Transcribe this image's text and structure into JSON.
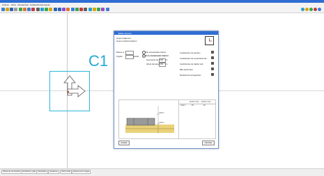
{
  "menu": [
    "Archivo",
    "Obra",
    "Introducción",
    "Gráfica/Ventas",
    "Ayuda"
  ],
  "canvas": {
    "column_label": "C1",
    "accent": "#24a9d8"
  },
  "status_tabs": [
    "Planta de cimentación",
    "Entrada de vigas",
    "Resultados",
    "Isovalores",
    "Deformada",
    "Esquema de cargas"
  ],
  "dialog": {
    "title": "Editar columna",
    "close": "×",
    "field_group": "Grupo final",
    "group_value": "Losa 1",
    "group_sub": "Grupo inicial  Fundación",
    "rotation_label": "Relevo a",
    "angle_label": "Ángulo",
    "angle_unit": "grados",
    "option1": "Sin encamisado inferior",
    "option2": "Con encamisado inferior",
    "opt_lbl1": "Geometría de apoyo",
    "opt_lbl2": "Altura del apoyo",
    "opt_val1": "0.00",
    "opt_val2": "0.00",
    "opt_unit": "m",
    "right_items": [
      "Coeficientes de pandeo",
      "Coeficientes de empotramiento",
      "Coeficientes de rigidez axil",
      "Bits electrónico",
      "Resistencia al fuego/tipo"
    ],
    "table_headers": [
      "",
      "Ancho X (m)",
      "Ancho Y (m)"
    ],
    "table_row": [
      "Losa 1",
      "40",
      "40"
    ],
    "dim1": "1.00 m",
    "dim2": "1.00 m",
    "btn_accept": "Aceptar",
    "btn_cancel": "Cancelar"
  }
}
